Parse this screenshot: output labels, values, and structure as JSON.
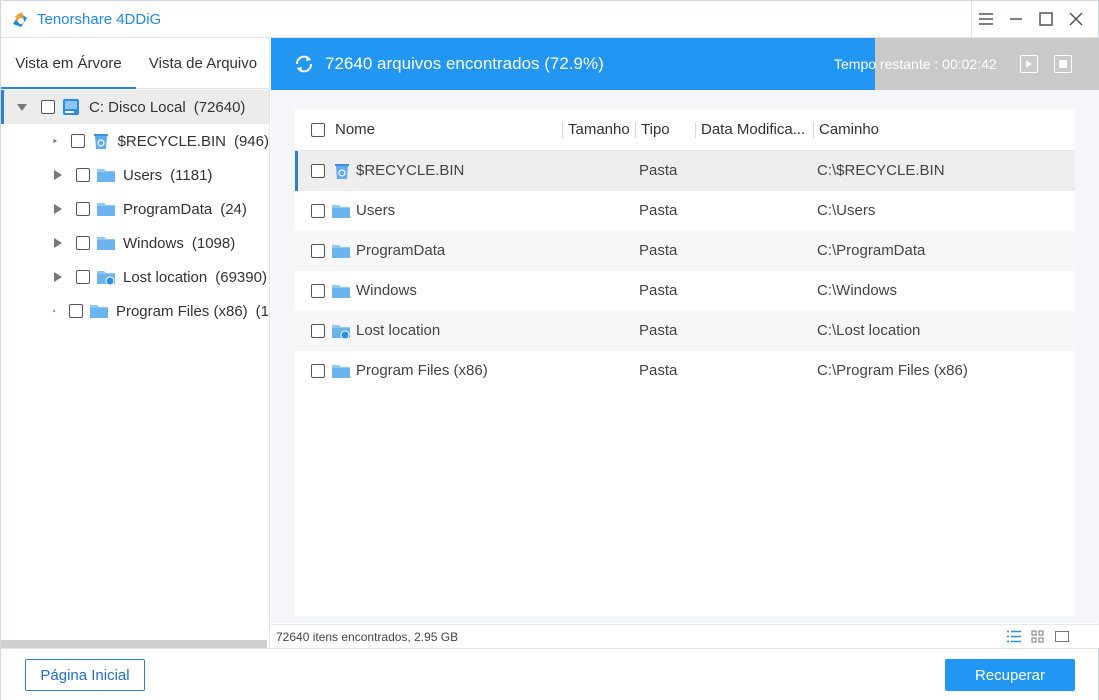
{
  "app": {
    "title": "Tenorshare 4DDiG",
    "accent": "#2196f3"
  },
  "window_controls": [
    "menu-icon",
    "minimize-icon",
    "maximize-icon",
    "close-icon"
  ],
  "left_tabs": [
    {
      "label": "Vista em Árvore",
      "active": true
    },
    {
      "label": "Vista de Arquivo",
      "active": false
    }
  ],
  "tree": {
    "root": {
      "label": "C: Disco Local",
      "count": "(72640)",
      "icon": "drive-icon"
    },
    "children": [
      {
        "label": "$RECYCLE.BIN",
        "count": "(946)",
        "icon": "recycle-bin-icon"
      },
      {
        "label": "Users",
        "count": "(1181)",
        "icon": "folder-icon"
      },
      {
        "label": "ProgramData",
        "count": "(24)",
        "icon": "folder-icon"
      },
      {
        "label": "Windows",
        "count": "(1098)",
        "icon": "folder-icon"
      },
      {
        "label": "Lost location",
        "count": "(69390)",
        "icon": "lost-folder-icon"
      },
      {
        "label": "Program Files (x86)",
        "count": "(1",
        "icon": "folder-icon"
      }
    ]
  },
  "scan": {
    "status": "72640 arquivos encontrados (72.9%)",
    "progress": 0.729,
    "time_remaining": "Tempo restante : 00:02:42"
  },
  "table": {
    "columns": [
      "Nome",
      "Tamanho",
      "Tipo",
      "Data Modifica...",
      "Caminho"
    ],
    "rows": [
      {
        "name": "$RECYCLE.BIN",
        "size": "",
        "type": "Pasta",
        "date": "",
        "path": "C:\\$RECYCLE.BIN",
        "icon": "recycle-bin-icon"
      },
      {
        "name": "Users",
        "size": "",
        "type": "Pasta",
        "date": "",
        "path": "C:\\Users",
        "icon": "folder-icon"
      },
      {
        "name": "ProgramData",
        "size": "",
        "type": "Pasta",
        "date": "",
        "path": "C:\\ProgramData",
        "icon": "folder-icon"
      },
      {
        "name": "Windows",
        "size": "",
        "type": "Pasta",
        "date": "",
        "path": "C:\\Windows",
        "icon": "folder-icon"
      },
      {
        "name": "Lost location",
        "size": "",
        "type": "Pasta",
        "date": "",
        "path": "C:\\Lost location",
        "icon": "lost-folder-icon"
      },
      {
        "name": "Program Files (x86)",
        "size": "",
        "type": "Pasta",
        "date": "",
        "path": "C:\\Program Files (x86)",
        "icon": "folder-icon"
      }
    ]
  },
  "status_bar": {
    "text": "72640 itens encontrados, 2.95 GB",
    "views": [
      "list-view-icon",
      "grid-view-icon",
      "preview-view-icon"
    ]
  },
  "footer": {
    "home_label": "Página Inicial",
    "recover_label": "Recuperar"
  }
}
